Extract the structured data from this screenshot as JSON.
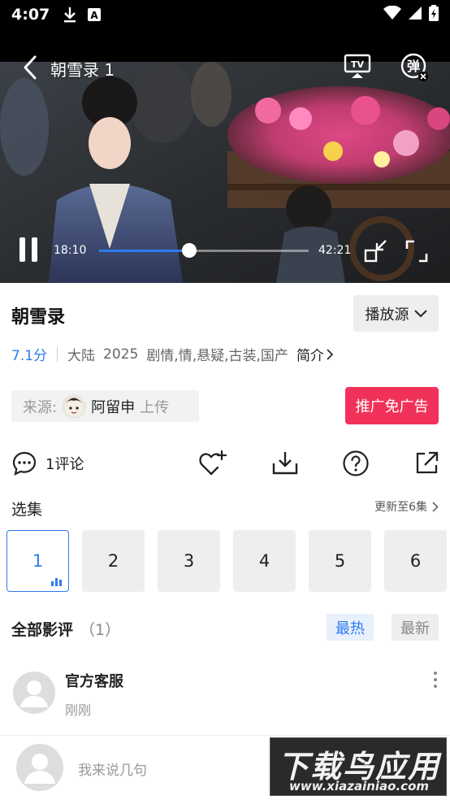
{
  "status_bar": {
    "time": "4:07",
    "icons": [
      "download-icon",
      "a-notification-icon"
    ],
    "right_icons": [
      "wifi-icon",
      "signal-icon",
      "battery-icon"
    ]
  },
  "player": {
    "title": "朝雪录 1",
    "current_time": "18:10",
    "total_time": "42:21",
    "progress_fraction": 0.43,
    "cast_label": "TV",
    "danmaku_label": "弹",
    "accent_color": "#2d7cf0"
  },
  "show": {
    "title": "朝雪录",
    "source_button": "播放源",
    "score": "7.1分",
    "region": "大陆",
    "year": "2025",
    "genres": "剧情,情,悬疑,古装,国产",
    "intro_label": "简介"
  },
  "uploader": {
    "label": "来源:",
    "name": "阿留申",
    "suffix": "上传"
  },
  "promo_button": "推广免广告",
  "promo_color": "#f0325a",
  "actions": {
    "comment_count": "1评论",
    "icons": [
      "comment-icon",
      "favorite-add-icon",
      "download-icon",
      "help-icon",
      "share-icon"
    ]
  },
  "episodes": {
    "heading": "选集",
    "update_text": "更新至6集",
    "items": [
      "1",
      "2",
      "3",
      "4",
      "5",
      "6"
    ],
    "active_index": 0
  },
  "reviews": {
    "heading": "全部影评",
    "count": "（1）",
    "tab_hot": "最热",
    "tab_new": "最新",
    "items": [
      {
        "name": "官方客服",
        "time": "刚刚"
      }
    ]
  },
  "bottom_bar": {
    "placeholder": "我来说几句"
  },
  "watermark": {
    "main": "下载鸟应用",
    "sub": "www.xiazainiao.com"
  }
}
